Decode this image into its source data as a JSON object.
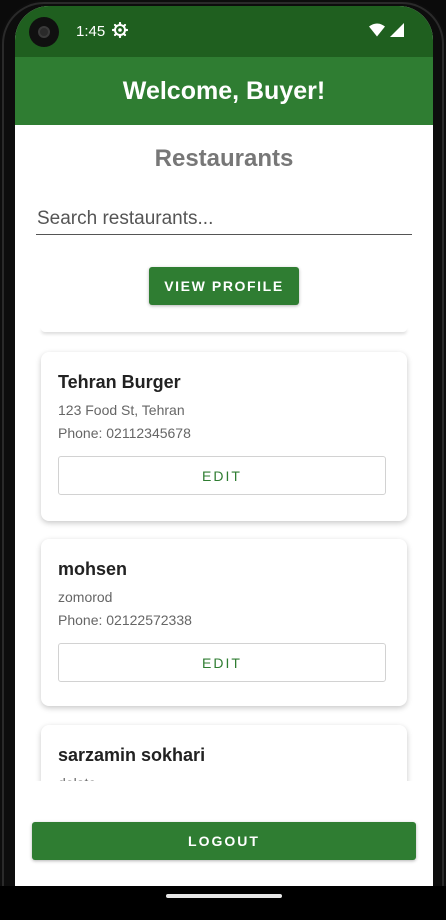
{
  "status_bar": {
    "time": "1:45",
    "icons": [
      "settings-gear-icon",
      "wifi-icon",
      "cell-signal-icon"
    ]
  },
  "app_bar": {
    "title": "Welcome, Buyer!"
  },
  "page": {
    "title": "Restaurants"
  },
  "search": {
    "placeholder": "Search restaurants...",
    "value": ""
  },
  "profile_button": {
    "label": "VIEW PROFILE"
  },
  "restaurants": [
    {
      "name": "Tehran Burger",
      "address": "123 Food St, Tehran",
      "phone": "Phone: 02112345678",
      "edit_label": "EDIT"
    },
    {
      "name": "mohsen",
      "address": "zomorod",
      "phone": "Phone: 02122572338",
      "edit_label": "EDIT"
    },
    {
      "name": "sarzamin sokhari",
      "address": "dolate"
    }
  ],
  "logout_button": {
    "label": "LOGOUT"
  },
  "colors": {
    "primary": "#2f7d32",
    "status_bar": "#1f5f1f",
    "title_gray": "#777777"
  }
}
